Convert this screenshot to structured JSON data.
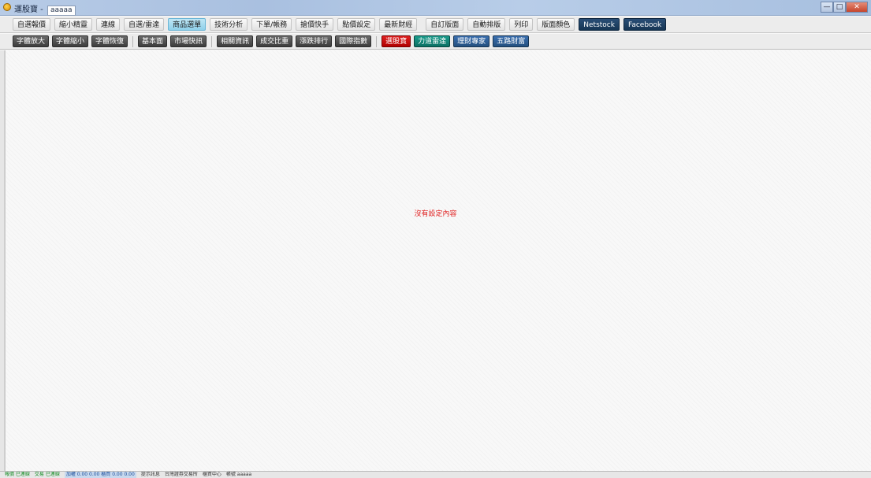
{
  "window": {
    "title": "運股寶 - ",
    "account": "aaaaa"
  },
  "window_buttons": {
    "minimize": "—",
    "maximize": "□",
    "close": "✕"
  },
  "main_toolbar": {
    "items": [
      {
        "label": "自選報價",
        "active": false
      },
      {
        "label": "縮小精靈",
        "active": false
      },
      {
        "label": "連線",
        "active": false
      },
      {
        "label": "自選/雷達",
        "active": false
      },
      {
        "label": "商品選單",
        "active": true
      },
      {
        "label": "技術分析",
        "active": false
      },
      {
        "label": "下單/帳務",
        "active": false
      },
      {
        "label": "搶價快手",
        "active": false
      },
      {
        "label": "點價設定",
        "active": false
      },
      {
        "label": "最新財經",
        "active": false
      },
      {
        "label": "自訂版面",
        "active": false
      },
      {
        "label": "自動排版",
        "active": false
      },
      {
        "label": "列印",
        "active": false
      },
      {
        "label": "版面顏色",
        "active": false
      }
    ],
    "social": [
      {
        "label": "Netstock"
      },
      {
        "label": "Facebook"
      }
    ]
  },
  "sub_toolbar": {
    "font_group": [
      {
        "label": "字體放大"
      },
      {
        "label": "字體縮小"
      },
      {
        "label": "字體恢復"
      }
    ],
    "info_group": [
      {
        "label": "基本面"
      },
      {
        "label": "市場快訊"
      }
    ],
    "market_group": [
      {
        "label": "相關資訊"
      },
      {
        "label": "成交比重"
      },
      {
        "label": "漲跌排行"
      },
      {
        "label": "國際指數"
      }
    ],
    "special_group": [
      {
        "label": "選股寶",
        "color": "#cc1010"
      },
      {
        "label": "力道雷達",
        "color": "#0f8577"
      },
      {
        "label": "理財專家",
        "color": "#2c5f98"
      },
      {
        "label": "五路財富",
        "color": "#2c5f98"
      }
    ]
  },
  "content": {
    "empty_message": "沒有設定內容"
  },
  "status_bar": {
    "items": [
      {
        "text": "報價 已連線",
        "tone": "green"
      },
      {
        "text": "交易 已連線",
        "tone": "green"
      },
      {
        "text": "加權 0.00 0.00 櫃買 0.00 0.00",
        "tone": "blue"
      },
      {
        "text": "提示訊息",
        "tone": "normal"
      },
      {
        "text": "台灣證券交易所",
        "tone": "normal"
      },
      {
        "text": "櫃買中心",
        "tone": "normal"
      },
      {
        "text": "帳號 aaaaa",
        "tone": "normal"
      }
    ]
  }
}
